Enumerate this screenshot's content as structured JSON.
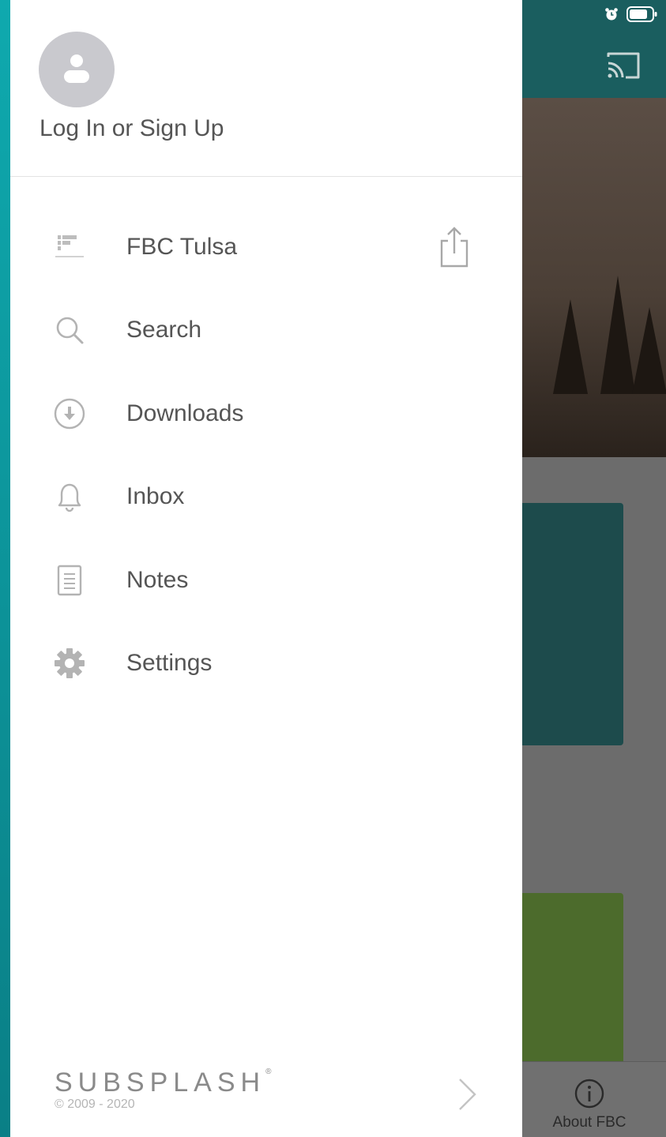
{
  "profile": {
    "login_label": "Log In or Sign Up"
  },
  "menu": {
    "items": [
      {
        "label": "FBC Tulsa",
        "icon": "fbc-logo-icon"
      },
      {
        "label": "Search",
        "icon": "search-icon"
      },
      {
        "label": "Downloads",
        "icon": "download-icon"
      },
      {
        "label": "Inbox",
        "icon": "bell-icon"
      },
      {
        "label": "Notes",
        "icon": "notes-icon"
      },
      {
        "label": "Settings",
        "icon": "gear-icon"
      }
    ]
  },
  "footer": {
    "brand": "SUBSPLASH",
    "copyright": "© 2009 - 2020"
  },
  "background_app": {
    "tab_about_label": "About FBC"
  },
  "colors": {
    "header_teal": "#1a5e5f",
    "drawer_bg": "#ffffff",
    "text_gray": "#555555",
    "icon_gray": "#b3b3b3"
  }
}
